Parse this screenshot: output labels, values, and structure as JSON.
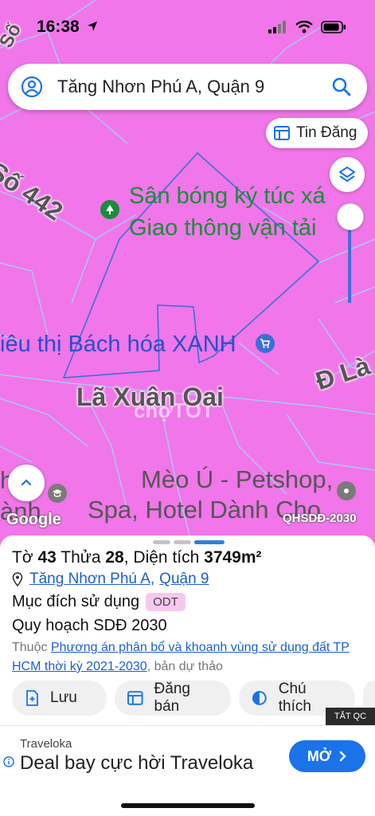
{
  "status_bar": {
    "time": "16:38"
  },
  "search": {
    "value": "Tăng Nhơn Phú A, Quận 9"
  },
  "map": {
    "tin_dang_label": "Tin Đăng",
    "labels": {
      "road_so_442": "Số 442",
      "road_so_top": "Số",
      "san_bong_line1": "Sân bóng ký túc xá",
      "san_bong_line2": "Giao thông vận tải",
      "bach_hoa": "iêu thị Bách hóa XANH",
      "road_d_lam": "Đ Là",
      "la_xuan_oai": "Lã Xuân Oai",
      "meo_u_line1": "Mèo Ú - Petshop,",
      "meo_u_line2": "Spa, Hotel Dành Cho",
      "left_partial_line1": "h",
      "left_partial_line2": "ành"
    },
    "google_logo": "Google",
    "qhsdd_badge": "QHSDĐ-2030",
    "watermark": "chợTỐT"
  },
  "sheet": {
    "title_to_label": "Tờ",
    "title_to_value": "43",
    "title_thua_label": "Thửa",
    "title_thua_value": "28",
    "title_area_label": "Diện tích",
    "title_area_value": "3749m²",
    "ward": "Tăng Nhơn Phú A",
    "district": "Quận 9",
    "purpose_label": "Mục đích sử dụng",
    "purpose_code": "ODT",
    "plan_label": "Quy hoạch SDĐ 2030",
    "note_prefix": "Thuộc",
    "note_link": "Phương án phân bổ và khoanh vùng sử dụng đất TP HCM thời kỳ 2021-2030",
    "note_suffix": ", bản dự thảo",
    "actions": [
      {
        "label": "Lưu"
      },
      {
        "label": "Đăng bán"
      },
      {
        "label": "Chú thích"
      }
    ]
  },
  "ad": {
    "close_label": "TẮT QC",
    "brand": "Traveloka",
    "title": "Deal bay cực hời Traveloka",
    "cta": "MỞ"
  },
  "colors": {
    "map_fill": "#f176e9",
    "parcel_line": "#3b6fd6",
    "accent_blue": "#1a73e8",
    "odt_badge": "#f7c8ef"
  }
}
